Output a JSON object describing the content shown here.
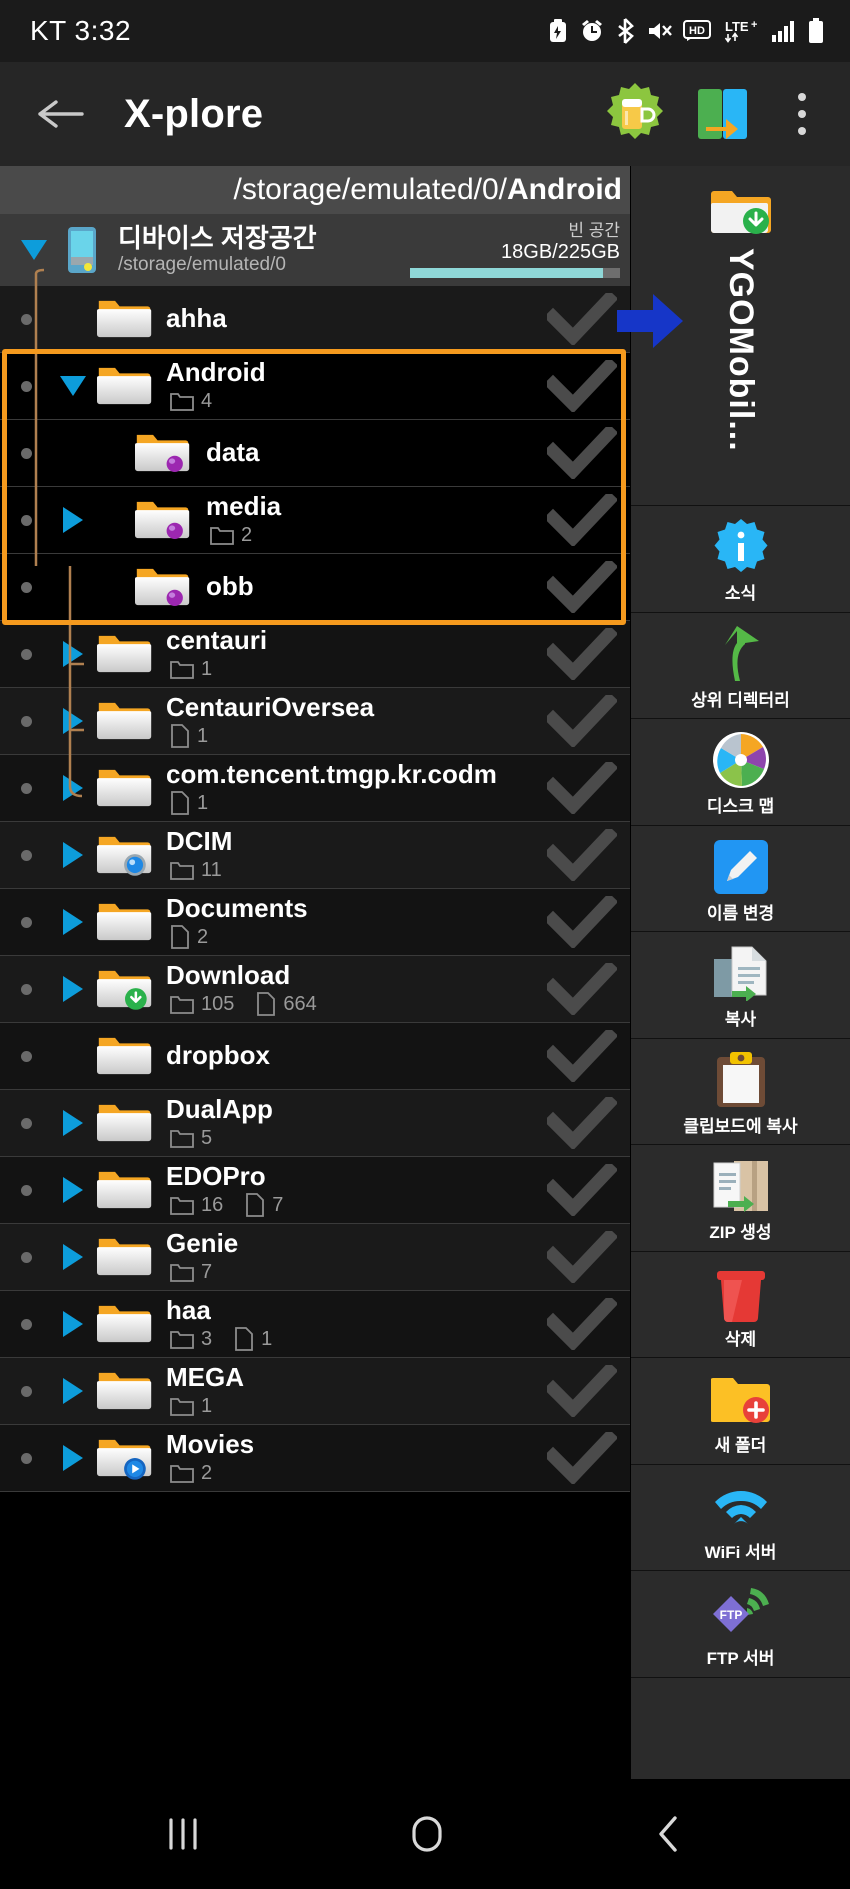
{
  "status_bar": {
    "carrier_time": "KT 3:32",
    "icons": [
      "battery-saver-icon",
      "alarm-icon",
      "bluetooth-icon",
      "mute-icon",
      "hd-icon",
      "lte-plus-icon",
      "signal-icon",
      "battery-icon"
    ]
  },
  "app_bar": {
    "back_label": "back-arrow",
    "title": "X-plore",
    "action_beer": "beer-donate-icon",
    "action_transfer": "wifi-transfer-icon",
    "overflow": "overflow-menu-icon"
  },
  "path_bar": {
    "prefix": "/storage/emulated/0/",
    "current": "Android",
    "device_icon": "phone-storage-icon"
  },
  "storage": {
    "title": "디바이스 저장공간",
    "subtitle": "/storage/emulated/0",
    "free_label": "빈 공간",
    "capacity": "18GB/225GB",
    "used_percent": 92,
    "bar_color": "#8fd8d8"
  },
  "files": [
    {
      "name": "ahha",
      "icon": "folder-icon",
      "expandable": false,
      "indent": false,
      "folders": null,
      "docs": null,
      "selected": false
    },
    {
      "name": "Android",
      "icon": "folder-icon",
      "expandable": true,
      "expanded": true,
      "indent": false,
      "folders": "4",
      "docs": null,
      "selected": true
    },
    {
      "name": "data",
      "icon": "folder-android-icon",
      "expandable": false,
      "indent": true,
      "folders": null,
      "docs": null,
      "selected": true
    },
    {
      "name": "media",
      "icon": "folder-android-icon",
      "expandable": true,
      "indent": true,
      "folders": "2",
      "docs": null,
      "selected": true
    },
    {
      "name": "obb",
      "icon": "folder-android-icon",
      "expandable": false,
      "indent": true,
      "folders": null,
      "docs": null,
      "selected": true
    },
    {
      "name": "centauri",
      "icon": "folder-icon",
      "expandable": true,
      "indent": false,
      "folders": "1",
      "docs": null,
      "selected": false
    },
    {
      "name": "CentauriOversea",
      "icon": "folder-icon",
      "expandable": true,
      "indent": false,
      "folders": null,
      "docs": "1",
      "selected": false
    },
    {
      "name": "com.tencent.tmgp.kr.codm",
      "icon": "folder-icon",
      "expandable": true,
      "indent": false,
      "folders": null,
      "docs": "1",
      "selected": false
    },
    {
      "name": "DCIM",
      "icon": "folder-camera-icon",
      "expandable": true,
      "indent": false,
      "folders": "11",
      "docs": null,
      "selected": false
    },
    {
      "name": "Documents",
      "icon": "folder-icon",
      "expandable": true,
      "indent": false,
      "folders": null,
      "docs": "2",
      "selected": false
    },
    {
      "name": "Download",
      "icon": "folder-download-icon",
      "expandable": true,
      "indent": false,
      "folders": "105",
      "docs": "664",
      "selected": false
    },
    {
      "name": "dropbox",
      "icon": "folder-icon",
      "expandable": false,
      "indent": false,
      "folders": null,
      "docs": null,
      "selected": false
    },
    {
      "name": "DualApp",
      "icon": "folder-icon",
      "expandable": true,
      "indent": false,
      "folders": "5",
      "docs": null,
      "selected": false
    },
    {
      "name": "EDOPro",
      "icon": "folder-icon",
      "expandable": true,
      "indent": false,
      "folders": "16",
      "docs": "7",
      "selected": false
    },
    {
      "name": "Genie",
      "icon": "folder-icon",
      "expandable": true,
      "indent": false,
      "folders": "7",
      "docs": null,
      "selected": false
    },
    {
      "name": "haa",
      "icon": "folder-icon",
      "expandable": true,
      "indent": false,
      "folders": "3",
      "docs": "1",
      "selected": false
    },
    {
      "name": "MEGA",
      "icon": "folder-icon",
      "expandable": true,
      "indent": false,
      "folders": "1",
      "docs": null,
      "selected": false
    },
    {
      "name": "Movies",
      "icon": "folder-video-icon",
      "expandable": true,
      "indent": false,
      "folders": "2",
      "docs": null,
      "selected": false
    }
  ],
  "sidebar": {
    "pinned": {
      "label": "YGOMobil...",
      "icon": "folder-download-icon",
      "arrow": "blue-right-arrow-icon"
    },
    "items": [
      {
        "label": "소식",
        "icon": "info-badge-icon"
      },
      {
        "label": "상위 디렉터리",
        "icon": "green-up-arrow-icon"
      },
      {
        "label": "디스크 맵",
        "icon": "pie-chart-icon"
      },
      {
        "label": "이름 변경",
        "icon": "pencil-edit-icon"
      },
      {
        "label": "복사",
        "icon": "copy-documents-icon"
      },
      {
        "label": "클립보드에 복사",
        "icon": "clipboard-icon"
      },
      {
        "label": "ZIP 생성",
        "icon": "zip-archive-icon"
      },
      {
        "label": "삭제",
        "icon": "red-trash-icon"
      },
      {
        "label": "새 폴더",
        "icon": "new-folder-icon"
      },
      {
        "label": "WiFi 서버",
        "icon": "wifi-icon"
      },
      {
        "label": "FTP 서버",
        "icon": "ftp-icon"
      }
    ]
  },
  "nav_bar": {
    "recents": "recents-icon",
    "home": "home-icon",
    "back": "back-icon"
  },
  "colors": {
    "accent_orange": "#f59a1e",
    "expand_blue": "#0d9ddb",
    "folder_orange": "#f5a623",
    "storage_bar": "#8fd8d8"
  }
}
